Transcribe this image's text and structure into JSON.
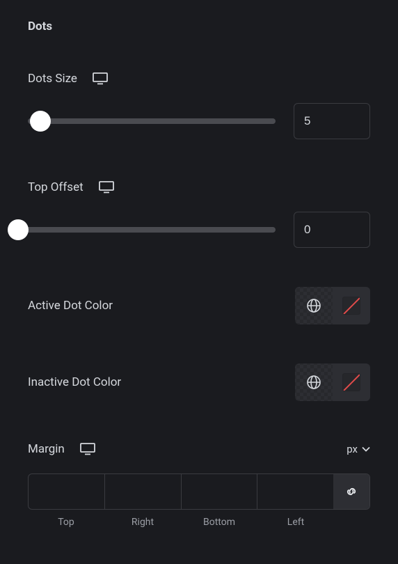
{
  "section": {
    "title": "Dots"
  },
  "dots_size": {
    "label": "Dots Size",
    "value": "5",
    "thumb_percent": 5
  },
  "top_offset": {
    "label": "Top Offset",
    "value": "0",
    "thumb_percent": 0
  },
  "active_color": {
    "label": "Active Dot Color"
  },
  "inactive_color": {
    "label": "Inactive Dot Color"
  },
  "margin": {
    "label": "Margin",
    "unit": "px",
    "top": "",
    "right": "",
    "bottom": "",
    "left": "",
    "captions": {
      "top": "Top",
      "right": "Right",
      "bottom": "Bottom",
      "left": "Left"
    }
  }
}
